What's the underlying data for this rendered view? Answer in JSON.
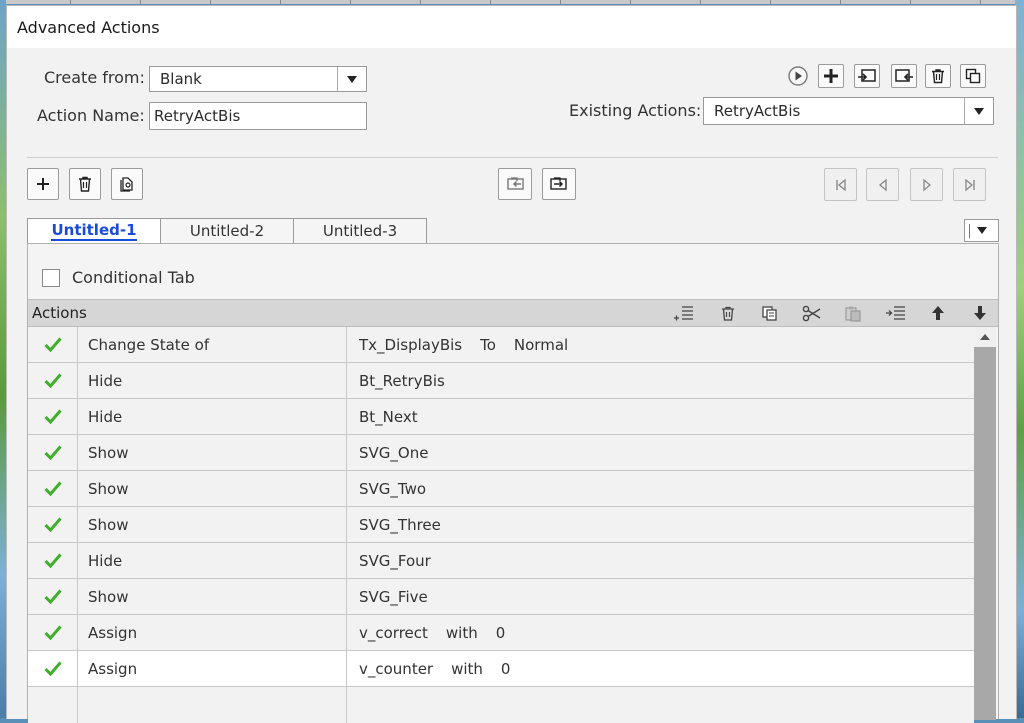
{
  "window": {
    "title": "Advanced Actions"
  },
  "form": {
    "create_from_label": "Create from:",
    "create_from_value": "Blank",
    "action_name_label": "Action Name:",
    "action_name_value": "RetryActBis",
    "existing_actions_label": "Existing Actions:",
    "existing_actions_value": "RetryActBis"
  },
  "icons": {
    "top_toolbar": [
      "preview-play-icon",
      "create-action-icon",
      "import-action-icon",
      "export-action-icon",
      "delete-action-icon",
      "duplicate-action-icon"
    ],
    "decision_toolbar": [
      "add-decision-icon",
      "delete-decision-icon",
      "duplicate-decision-icon",
      "import-decision-icon",
      "export-decision-icon"
    ],
    "nav_toolbar": [
      "first-icon",
      "previous-icon",
      "next-icon",
      "last-icon"
    ],
    "actions_toolbar": [
      "add-action-icon",
      "delete-icon",
      "copy-icon",
      "cut-icon",
      "paste-icon",
      "insert-icon",
      "move-up-icon",
      "move-down-icon"
    ]
  },
  "tabs": [
    {
      "label": "Untitled-1",
      "active": true
    },
    {
      "label": "Untitled-2",
      "active": false
    },
    {
      "label": "Untitled-3",
      "active": false
    }
  ],
  "conditional": {
    "label": "Conditional Tab",
    "checked": false
  },
  "actions_panel": {
    "title": "Actions"
  },
  "actions": [
    {
      "action": "Change State of",
      "target": "Tx_DisplayBis",
      "conj": "To",
      "value": "Normal"
    },
    {
      "action": "Hide",
      "target": "Bt_RetryBis",
      "conj": "",
      "value": ""
    },
    {
      "action": "Hide",
      "target": "Bt_Next",
      "conj": "",
      "value": ""
    },
    {
      "action": "Show",
      "target": "SVG_One",
      "conj": "",
      "value": ""
    },
    {
      "action": "Show",
      "target": "SVG_Two",
      "conj": "",
      "value": ""
    },
    {
      "action": "Show",
      "target": "SVG_Three",
      "conj": "",
      "value": ""
    },
    {
      "action": "Hide",
      "target": "SVG_Four",
      "conj": "",
      "value": ""
    },
    {
      "action": "Show",
      "target": "SVG_Five",
      "conj": "",
      "value": ""
    },
    {
      "action": "Assign",
      "target": "v_correct",
      "conj": "with",
      "value": "0"
    },
    {
      "action": "Assign",
      "target": "v_counter",
      "conj": "with",
      "value": "0",
      "selected": true
    }
  ],
  "colors": {
    "accent_tab": "#1a4cd8",
    "check": "#3fae2a",
    "header_bg": "#d6d6d6"
  }
}
